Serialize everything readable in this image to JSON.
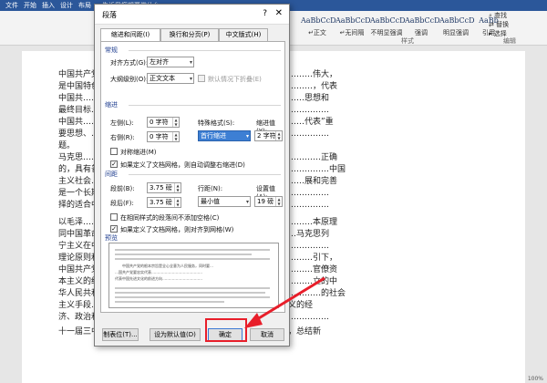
{
  "ribbon": {
    "top_items": [
      "告诉我您想要做什么"
    ],
    "menu_items": [
      "文件",
      "开始",
      "插入",
      "设计",
      "布局"
    ],
    "styles": [
      {
        "sample": "AaBbCcD",
        "name": "↵正文"
      },
      {
        "sample": "AaBbCcD",
        "name": "↵无间隔"
      },
      {
        "sample": "AaBbCcD",
        "name": "不明显强调"
      },
      {
        "sample": "AaBbCcD",
        "name": "强调"
      },
      {
        "sample": "AaBbCcD",
        "name": "明显强调"
      },
      {
        "sample": "AaBb",
        "name": "引用"
      }
    ],
    "side_group": [
      "查找",
      "替换",
      "选择"
    ],
    "section_styles": "样式",
    "section_edit": "编辑"
  },
  "document": {
    "lines": [
      "中国共产党人…………………………………………………………………伟大，",
      "是中国特色……………………………………………………………………，代表",
      "中国共………………………………………………………………………思想和",
      "最终目标……………………………………………………………………………",
      "中国共………………………………………………………………………代表”重",
      "要思想、……………………………………………………………………………",
      "题。",
      "马克思……………………………………………………………………………正确",
      "的，具有普…………………………………………………………………………中国",
      "主义社会……………………………………………………………………展和完善",
      "是一个长期…………………………………………………………………………",
      "择的适合中…………………………………………………………………………",
      "以毛泽…………………………………………………………………………本原理",
      "同中国革命………………………………………………………………马克思列",
      "宁主义在中…………………………………………………………………………",
      "理论原则和……………………………………………………………………引下，",
      "中国共产党……………………………………………………………………官僚资",
      "本主义的统……………………………………………………………………立的中",
      "华人民共和国，确立了社会主义基本制度，…………………………………的社会",
      "主义手段……社会主义的过渡，解放了社会主义制度……社会主义的经",
      "济、政治和…………………………………………………………………………",
      "十一届三中全会以来，以邓小平同志为主要代表的中国共产党人，总结新"
    ]
  },
  "dialog": {
    "title": "段落",
    "help": "?",
    "close": "✕",
    "tabs": [
      "缩进和间距(I)",
      "换行和分页(P)",
      "中文版式(H)"
    ],
    "general": {
      "heading": "常规",
      "alignment_label": "对齐方式(G):",
      "alignment_value": "左对齐",
      "outline_label": "大纲级别(O):",
      "outline_value": "正文文本",
      "collapsed_label": "默认情况下折叠(E)"
    },
    "indent": {
      "heading": "缩进",
      "left_label": "左侧(L):",
      "left_value": "0 字符",
      "right_label": "右侧(R):",
      "right_value": "0 字符",
      "special_label": "特殊格式(S):",
      "special_value": "首行缩进",
      "by_label": "缩进值(Y):",
      "by_value": "2 字符",
      "mirror_label": "对称缩进(M)",
      "grid_label": "如果定义了文档网格，则自动调整右缩进(D)"
    },
    "spacing": {
      "heading": "间距",
      "before_label": "段前(B):",
      "before_value": "3.75 磅",
      "after_label": "段后(F):",
      "after_value": "3.75 磅",
      "line_label": "行距(N):",
      "line_value": "最小值",
      "at_label": "设置值(A):",
      "at_value": "19 磅",
      "no_space_label": "在相同样式的段落间不添加空格(C)",
      "snap_label": "如果定义了文档网格，则对齐到网格(W)"
    },
    "preview": {
      "heading": "预览",
      "sample_lines": [
        "中国共产党的根本宗旨是全心全意为人民服务，同时要…",
        "…国共产党要忠实代表……………………………………",
        "代表中国先进文化的前进方向……………………………"
      ]
    },
    "buttons": {
      "tabs": "制表位(T)...",
      "default": "设为默认值(D)",
      "ok": "确定",
      "cancel": "取消"
    }
  },
  "status": "100%"
}
